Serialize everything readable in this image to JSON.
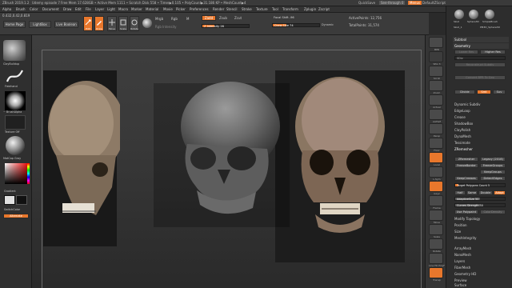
{
  "titlebar": {
    "app": "ZBrush 2019.1.2",
    "doc": "Udemy episode 7",
    "stats": "Free Mem 17.628GB • Active Mem 1111 • Scratch Disk 558 • Timer▶0.105 • PolyCount▶31.186 KP • MeshCount▶4",
    "quicksave": "QuickSave",
    "seethrough": "See-through 0",
    "menus": "Menus",
    "script": "DefaultZScript"
  },
  "menubar": [
    "Alpha",
    "Brush",
    "Color",
    "Document",
    "Draw",
    "Edit",
    "File",
    "Layer",
    "Light",
    "Macro",
    "Marker",
    "Material",
    "Movie",
    "Picker",
    "Preferences",
    "Render",
    "Stencil",
    "Stroke",
    "Texture",
    "Tool",
    "Transform",
    "Zplugin",
    "Zscript"
  ],
  "coords": "0.432,0.42,0.819",
  "topshelf": {
    "home": "Home Page",
    "lightbox": "LightBox",
    "live_boolean": "Live Boolean",
    "edit": "Edit",
    "draw": "Draw",
    "move": "Move",
    "scale": "Scale",
    "rotate": "Rotate",
    "mrgb": "Mrgb",
    "rgb": "Rgb",
    "m": "M",
    "zadd": "Zadd",
    "zsub": "Zsub",
    "zcut": "Zcut",
    "rgb_intensity": "Rgb Intensity",
    "z_intensity": "Z Intensity 26",
    "focal_shift": "Focal Shift -96",
    "draw_size": "Draw Size 74",
    "dynamic": "Dynamic",
    "active_points": "ActivePoints: 12,756",
    "total_points": "TotalPoints: 31,574"
  },
  "lefttray": {
    "brush": "ClayBuildup",
    "stroke": "Freehand",
    "alpha": "~ BrushAlpha",
    "texture": "Texture Off",
    "material": "MatCap Gray",
    "gradient": "Gradient",
    "switchcolor": "SwitchColor",
    "alternate": "Alternate"
  },
  "righttray": [
    "BPR",
    "SPix 3",
    "Scroll",
    "Zoom",
    "Actual",
    "AAHalf",
    "Persp",
    "Floor",
    "Local",
    "L.Sym",
    "Gxyz",
    "Frame",
    "Move",
    "Scale",
    "Rotate",
    "Line Fill PolyF",
    "Transp",
    "Ghost",
    "Solo",
    "Xpose"
  ],
  "palette": {
    "tool_names": [
      "Skull",
      "Sphere3D",
      "SimpleBrush",
      "Skull_1",
      "PM3D_Sphere3D"
    ],
    "subtool": "Subtool",
    "geometry": "Geometry",
    "lower_res": "Lower Res",
    "higher_res": "Higher Res",
    "sdiv": "SDiv",
    "reconstruct": "Reconstruct Subdiv",
    "convert": "Convert BPR To Geo",
    "divide": "Divide",
    "smt": "Smt",
    "suv": "Suv",
    "relax": "ReUV",
    "dynamic_subdiv": "Dynamic Subdiv",
    "edgeloop": "EdgeLoop",
    "crease": "Crease",
    "shadowbox": "ShadowBox",
    "claypolish": "ClayPolish",
    "dynamesh": "DynaMesh",
    "tessimate": "Tessimate",
    "zremesher": "ZRemesher",
    "zremesher_btn": "ZRemesher",
    "legacy": "Legacy (2018)",
    "freeze_border": "FreezeBorder",
    "freeze_groups": "FreezeGroups",
    "keep_groups": "KeepGroups",
    "keep_creases": "KeepCreases",
    "detect_edges": "DetectEdges",
    "target_polys": "Target Polygons Count 5",
    "half": "Half",
    "same": "Same",
    "double": "Double",
    "adapt": "Adapt",
    "adaptive_size": "AdaptiveSize 50",
    "curves_strength": "Curves Strength 50",
    "use_polypaint": "Use Polypaint",
    "color_density": "ColorDensity",
    "modify_topology": "Modify Topology",
    "position": "Position",
    "size": "Size",
    "mesh_integrity": "MeshIntegrity",
    "arraymesh": "ArrayMesh",
    "nanomesh": "NanoMesh",
    "layers": "Layers",
    "fibermesh": "FiberMesh",
    "geometry_hd": "Geometry HD",
    "preview": "Preview",
    "surface": "Surface"
  }
}
